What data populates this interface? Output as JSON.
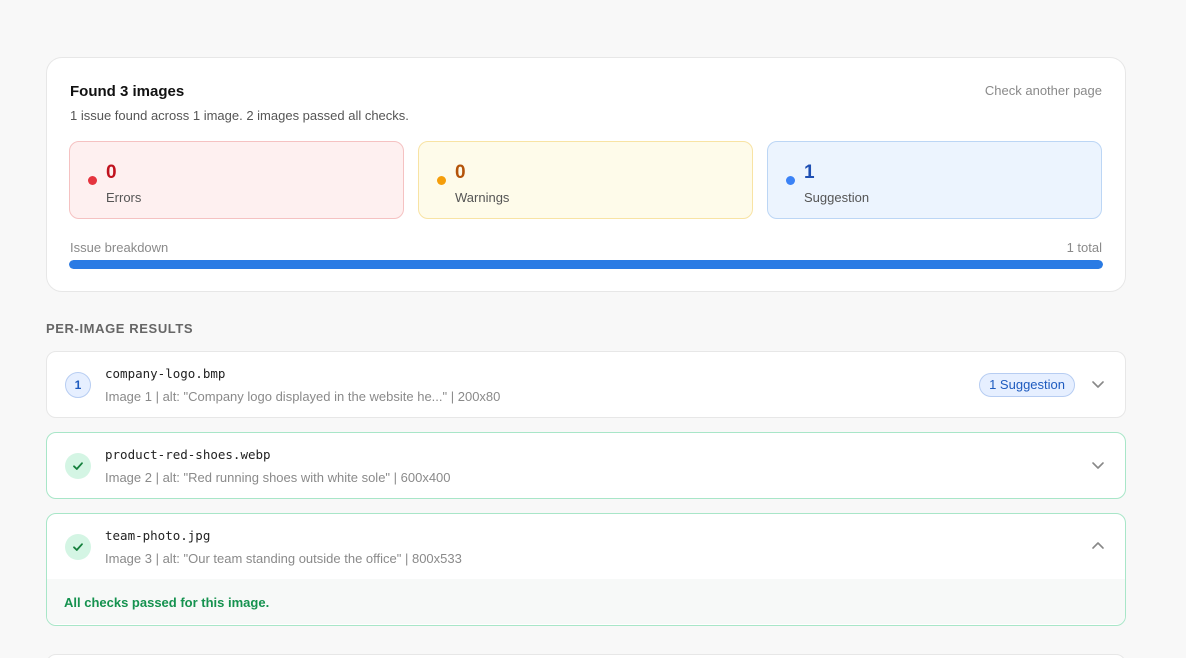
{
  "summary": {
    "title": "Found 3 images",
    "subtitle": "1 issue found across 1 image. 2 images passed all checks.",
    "check_another": "Check another page",
    "stats": {
      "errors": {
        "count": "0",
        "label": "Errors",
        "color": "#e5343f",
        "text_color": "#c0121e"
      },
      "warnings": {
        "count": "0",
        "label": "Warnings",
        "color": "#f59e0b",
        "text_color": "#b45309"
      },
      "suggestions": {
        "count": "1",
        "label": "Suggestion",
        "color": "#3b82f6",
        "text_color": "#1e4fb3"
      }
    },
    "breakdown": {
      "label": "Issue breakdown",
      "total": "1 total",
      "suggestions_fraction": 1.0
    }
  },
  "section_heading": "PER-IMAGE RESULTS",
  "images": [
    {
      "filename": "company-logo.bmp",
      "meta": "Image 1 | alt: \"Company logo displayed in the website he...\" | 200x80",
      "badge": "1",
      "status": "suggestion",
      "pill": "1 Suggestion",
      "chevron": "chevron-down-icon"
    },
    {
      "filename": "product-red-shoes.webp",
      "meta": "Image 2 | alt: \"Red running shoes with white sole\" | 600x400",
      "status": "passed",
      "chevron": "chevron-down-icon"
    },
    {
      "filename": "team-photo.jpg",
      "meta": "Image 3 | alt: \"Our team standing outside the office\" | 800x533",
      "status": "passed",
      "expanded": true,
      "chevron": "chevron-up-icon",
      "passed_message": "All checks passed for this image."
    }
  ]
}
